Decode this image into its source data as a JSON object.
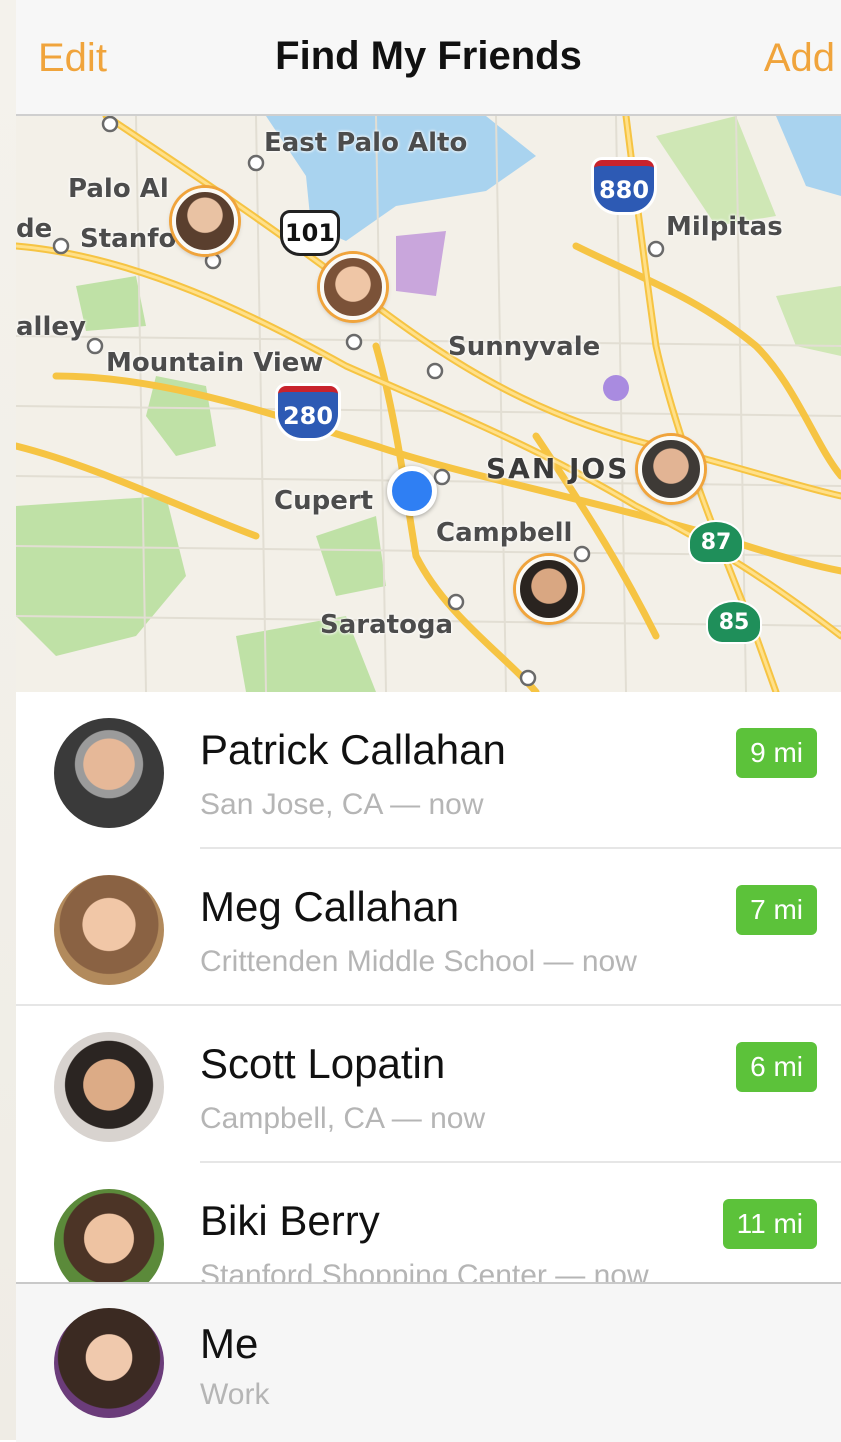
{
  "navbar": {
    "edit_label": "Edit",
    "title": "Find My Friends",
    "add_label": "Add"
  },
  "map": {
    "labels": {
      "east_palo_alto": "East Palo Alto",
      "palo_alto": "Palo Al",
      "stanford": "Stanfo",
      "de": "de",
      "milpitas": "Milpitas",
      "valley": "alley",
      "mountain_view": "Mountain View",
      "sunnyvale": "Sunnyvale",
      "san_jose": "SAN JOS",
      "cupertino": "Cupert",
      "campbell": "Campbell",
      "saratoga": "Saratoga"
    },
    "shields": {
      "i880": "880",
      "us101": "101",
      "i280": "280",
      "ca87": "87",
      "ca85": "85"
    }
  },
  "friends": [
    {
      "name": "Patrick Callahan",
      "location": "San Jose, CA",
      "time": "now",
      "distance": "9 mi"
    },
    {
      "name": "Meg Callahan",
      "location": "Crittenden Middle School",
      "time": "now",
      "distance": "7 mi"
    },
    {
      "name": "Scott Lopatin",
      "location": "Campbell, CA",
      "time": "now",
      "distance": "6 mi"
    },
    {
      "name": "Biki Berry",
      "location": "Stanford Shopping Center",
      "time": "now",
      "distance": "11 mi"
    }
  ],
  "separator": " — ",
  "me": {
    "name": "Me",
    "location": "Work"
  },
  "colors": {
    "accent": "#f0a43c",
    "badge": "#5cc23a",
    "me_dot": "#2f7ff3"
  }
}
